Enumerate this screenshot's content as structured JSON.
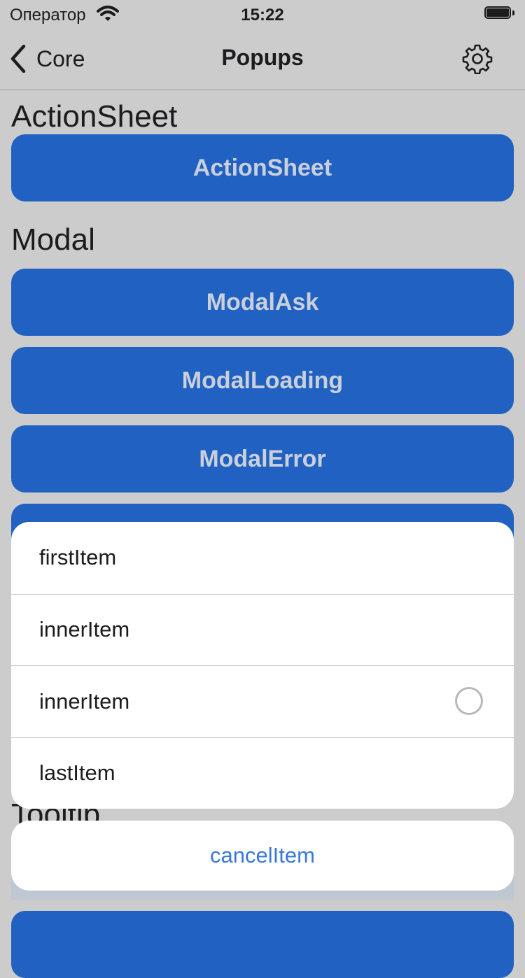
{
  "status_bar": {
    "carrier": "Оператор",
    "time": "15:22"
  },
  "nav": {
    "back_label": "Core",
    "title": "Popups"
  },
  "sections": {
    "action_sheet": {
      "title": "ActionSheet",
      "button": "ActionSheet"
    },
    "modal": {
      "title": "Modal",
      "buttons": [
        "ModalAsk",
        "ModalLoading",
        "ModalError"
      ]
    },
    "tooltip": {
      "title": "Tooltip"
    }
  },
  "sheet": {
    "items": [
      {
        "label": "firstItem"
      },
      {
        "label": "innerItem"
      },
      {
        "label": "innerItem"
      },
      {
        "label": "lastItem"
      }
    ],
    "cancel": "cancelItem"
  },
  "colors": {
    "background": "#cccccc",
    "button": "#2161c1",
    "button_text": "#c9d0db",
    "cancel_text": "#3a78d8"
  }
}
